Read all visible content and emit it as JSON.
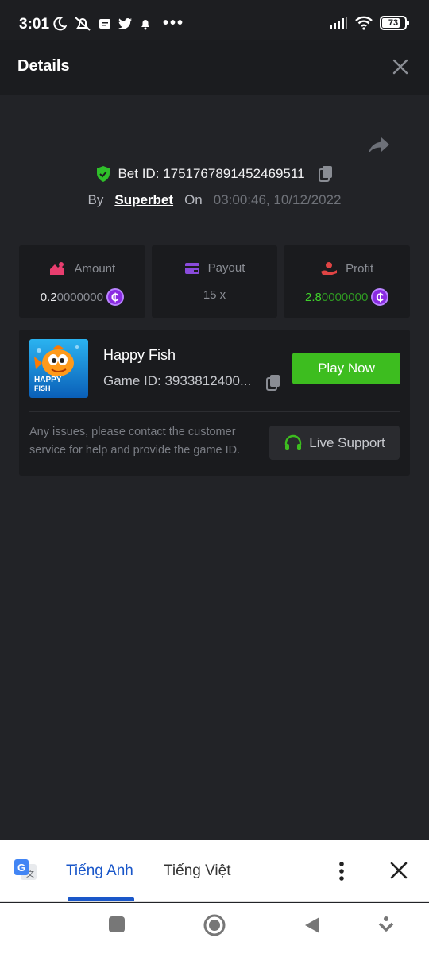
{
  "status_bar": {
    "time": "3:01",
    "battery": "73",
    "battery_level_percent": 73,
    "icons": [
      "moon-icon",
      "bell-off-icon",
      "message-icon",
      "twitter-icon",
      "notification-bell-icon",
      "more-dots-icon",
      "signal-icon",
      "wifi-icon",
      "battery-icon"
    ]
  },
  "header": {
    "title": "Details"
  },
  "bet": {
    "id_label": "Bet ID: 1751767891452469511",
    "by_label": "By",
    "provider": "Superbet",
    "on_label": "On",
    "datetime": "03:00:46, 10/12/2022"
  },
  "stats": [
    {
      "label": "Amount",
      "value_main": "0.2",
      "value_rest": "0000000",
      "coin": "₵",
      "color": "#e83e6f"
    },
    {
      "label": "Payout",
      "value": "15 x",
      "color": "#8a4bdc"
    },
    {
      "label": "Profit",
      "value_main": "2.8",
      "value_rest": "0000000",
      "coin": "₵",
      "color": "#e04444"
    }
  ],
  "game": {
    "name": "Happy Fish",
    "game_id": "Game ID: 3933812400...",
    "play_label": "Play Now",
    "support_text": "Any issues, please contact the customer service for help and provide the game ID.",
    "support_label": "Live Support",
    "thumb_text_1": "HAPPY",
    "thumb_text_2": "FISH"
  },
  "translate_bar": {
    "tab_source": "Tiếng Anh",
    "tab_target": "Tiếng Việt"
  },
  "colors": {
    "accent_green": "#3dbd1f",
    "profit_green": "#3fcf2b",
    "coin_purple": "#8a2be2",
    "translate_blue": "#1a57c9"
  }
}
